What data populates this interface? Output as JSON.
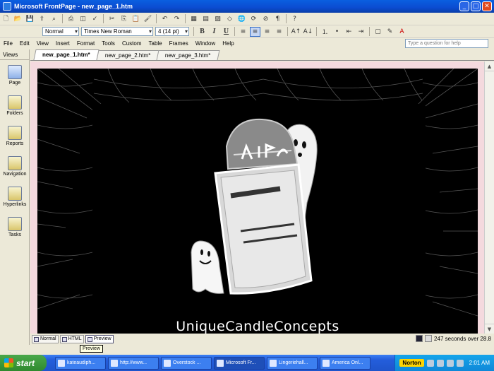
{
  "window": {
    "title": "Microsoft FrontPage - new_page_1.htm"
  },
  "toolbar": {
    "style_value": "Normal",
    "font_value": "Times New Roman",
    "size_value": "4  (14 pt)",
    "bold": "B",
    "italic": "I",
    "underline": "U"
  },
  "menu": [
    "File",
    "Edit",
    "View",
    "Insert",
    "Format",
    "Tools",
    "Custom",
    "Table",
    "Frames",
    "Window",
    "Help"
  ],
  "help_placeholder": "Type a question for help",
  "views": {
    "header": "Views",
    "items": [
      "Page",
      "Folders",
      "Reports",
      "Navigation",
      "Hyperlinks",
      "Tasks"
    ]
  },
  "tabs": [
    "new_page_1.htm*",
    "new_page_2.htm*",
    "new_page_3.htm*"
  ],
  "page_content": {
    "brand_text": "UniqueCandleConcepts"
  },
  "view_tabs": [
    "Normal",
    "HTML",
    "Preview"
  ],
  "tooltip": "Preview",
  "status": {
    "download_time": "247 seconds over 28.8"
  },
  "taskbar": {
    "start_label": "start",
    "tasks": [
      "kateaudiph...",
      "http://www...",
      "Overstock ...",
      "Microsoft Fr...",
      "Lingeriehall...",
      "America Onl..."
    ],
    "norton_label": "Norton",
    "clock": "2:01 AM"
  }
}
